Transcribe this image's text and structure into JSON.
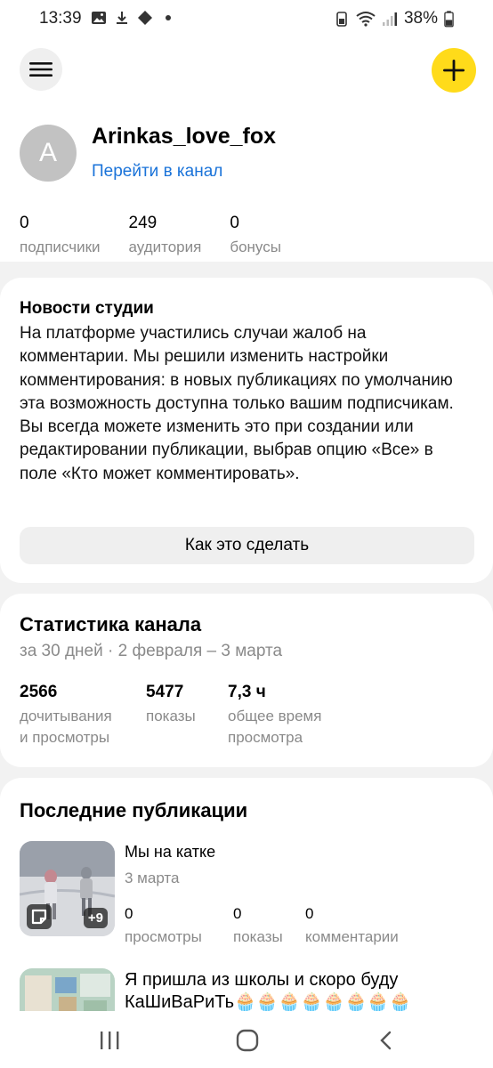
{
  "status_bar": {
    "time": "13:39",
    "battery": "38%"
  },
  "header": {
    "menu_icon": "menu-icon",
    "add_icon": "plus-icon",
    "accent_color": "#ffdb1a"
  },
  "profile": {
    "avatar_letter": "A",
    "channel_name": "Arinkas_love_fox",
    "channel_link": "Перейти в канал",
    "stats": [
      {
        "value": "0",
        "label": "подписчики"
      },
      {
        "value": "249",
        "label": "аудитория"
      },
      {
        "value": "0",
        "label": "бонусы"
      }
    ]
  },
  "news": {
    "title": "Новости студии",
    "body": "На платформе участились случаи жалоб на комментарии. Мы решили изменить настройки комментирования: в новых публикациях по умолчанию эта возможность доступна только вашим подписчикам. Вы всегда можете изменить это при создании или редактировании публикации, выбрав опцию «Все» в поле «Кто может комментировать».",
    "button": "Как это сделать"
  },
  "channel_stats": {
    "title": "Статистика канала",
    "period": "за 30 дней · 2 февраля – 3 марта",
    "metrics": [
      {
        "value": "2566",
        "label_1": "дочитывания",
        "label_2": "и просмотры"
      },
      {
        "value": "5477",
        "label_1": "показы",
        "label_2": ""
      },
      {
        "value": "7,3 ч",
        "label_1": "общее время",
        "label_2": "просмотра"
      }
    ]
  },
  "publications": {
    "title": "Последние публикации",
    "items": [
      {
        "title": "Мы на катке",
        "date": "3 марта",
        "extra_count": "+9",
        "stats": [
          {
            "value": "0",
            "label": "просмотры"
          },
          {
            "value": "0",
            "label": "показы"
          },
          {
            "value": "0",
            "label": "комментарии"
          }
        ]
      },
      {
        "title_line_1": "Я пришла из школы и скоро буду",
        "title_line_2": "КаШиВаРиТь🧁🧁🧁🧁🧁🧁🧁🧁"
      }
    ]
  }
}
